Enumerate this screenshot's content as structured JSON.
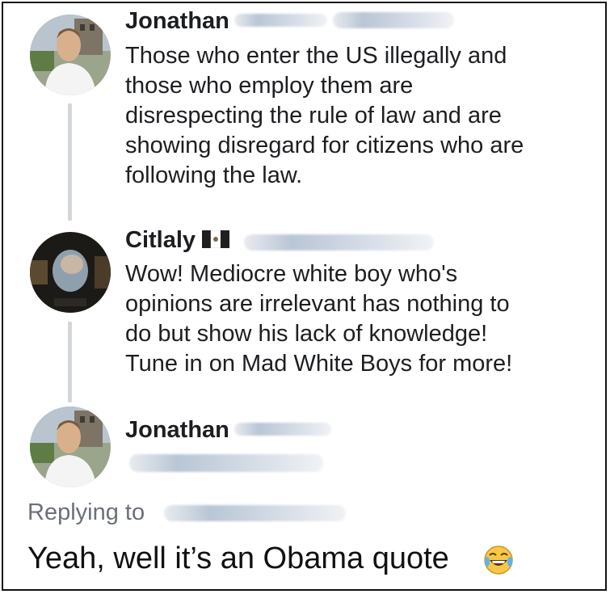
{
  "comments": [
    {
      "author": "Jonathan",
      "text": "Those who enter the US illegally and\nthose who employ them are\ndisrespecting the rule of law and are\nshowing disregard for citizens who are\nfollowing the law."
    },
    {
      "author": "Citlaly",
      "flag_icon": "mexico-flag-icon",
      "text": "Wow! Mediocre white boy who's\nopinions are irrelevant has nothing to\ndo but show his lack of knowledge!\nTune in on Mad White Boys for more!"
    },
    {
      "author": "Jonathan"
    }
  ],
  "reply": {
    "label": "Replying to",
    "text": "Yeah, well it’s an Obama quote",
    "emoji_icon": "laughing-tears-emoji-icon"
  },
  "colors": {
    "thread_line": "#d3d6db",
    "secondary_text": "#6b7078",
    "redaction": "#b9c6d6"
  }
}
